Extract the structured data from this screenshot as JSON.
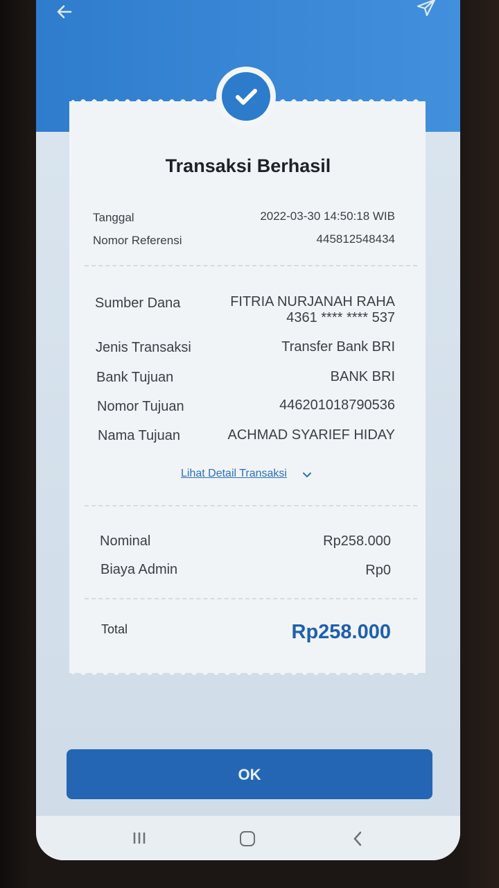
{
  "header": {
    "back_icon": "arrow-left-icon",
    "share_icon": "send-icon"
  },
  "status_icon": "checkmark-icon",
  "title": "Transaksi Berhasil",
  "meta": {
    "date_label": "Tanggal",
    "date_value": "2022-03-30 14:50:18 WIB",
    "ref_label": "Nomor Referensi",
    "ref_value": "445812548434"
  },
  "details": {
    "source_label": "Sumber Dana",
    "source_name": "FITRIA NURJANAH RAHA",
    "source_account": "4361 **** **** 537",
    "type_label": "Jenis Transaksi",
    "type_value": "Transfer Bank BRI",
    "bank_label": "Bank Tujuan",
    "bank_value": "BANK BRI",
    "dest_number_label": "Nomor Tujuan",
    "dest_number_value": "446201018790536",
    "dest_name_label": "Nama Tujuan",
    "dest_name_value": "ACHMAD SYARIEF HIDAY"
  },
  "detail_link": "Lihat Detail Transaksi",
  "amounts": {
    "nominal_label": "Nominal",
    "nominal_value": "Rp258.000",
    "admin_label": "Biaya Admin",
    "admin_value": "Rp0",
    "total_label": "Total",
    "total_value": "Rp258.000"
  },
  "ok_label": "OK",
  "colors": {
    "primary_blue": "#2d7ccc",
    "button_blue": "#2466b4",
    "total_blue": "#1f5fae",
    "receipt_bg": "#f1f4f6"
  }
}
